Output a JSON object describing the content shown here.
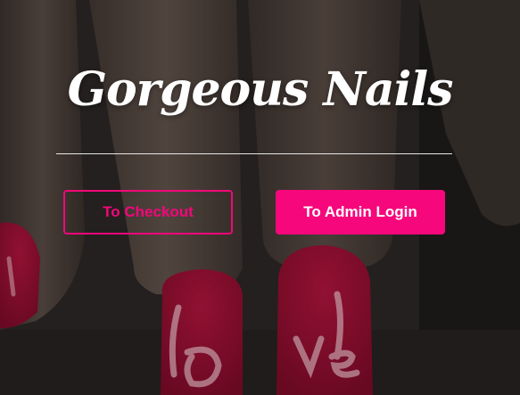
{
  "hero": {
    "title": "Gorgeous Nails"
  },
  "actions": {
    "checkout_label": "To Checkout",
    "admin_login_label": "To Admin Login"
  },
  "colors": {
    "accent": "#f7077c",
    "title": "#ffffff",
    "divider": "#e6e6e6"
  }
}
